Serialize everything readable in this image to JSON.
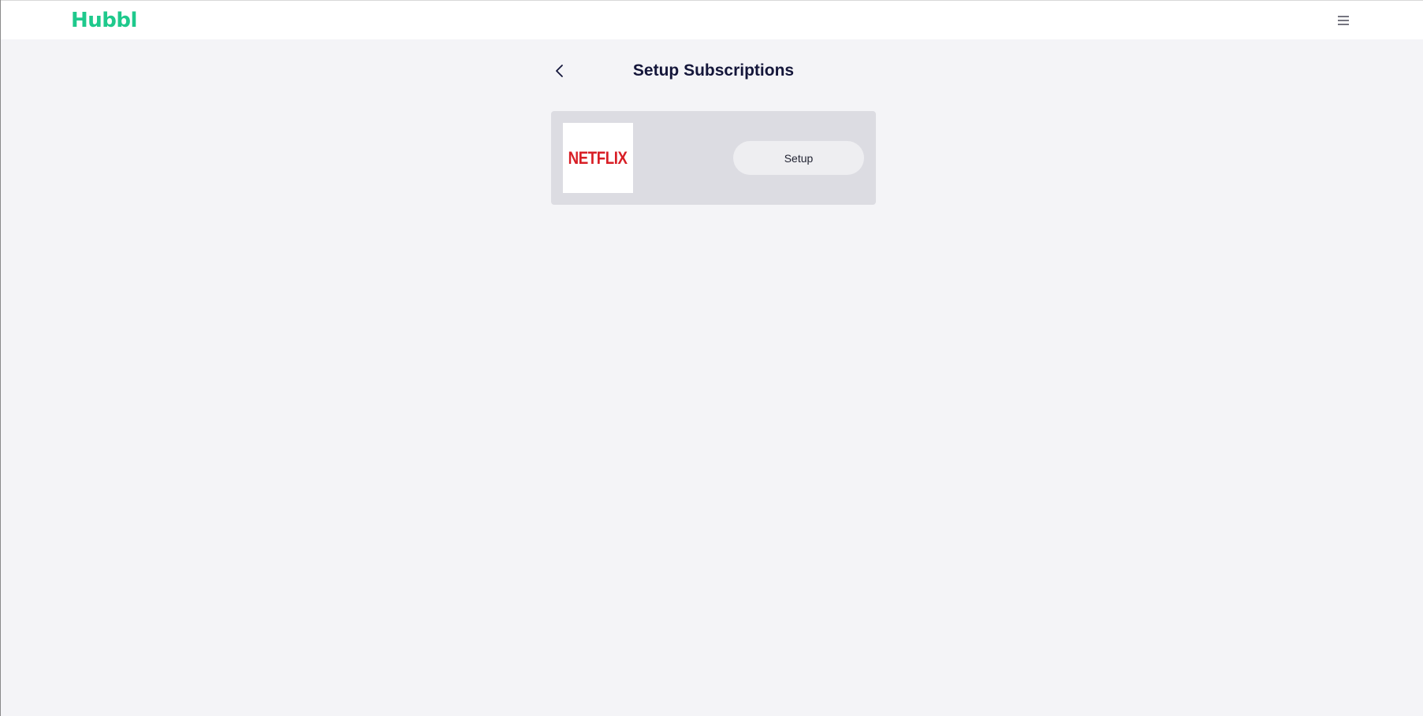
{
  "header": {
    "brand": "Hubbl",
    "menu_icon": "hamburger-menu-icon"
  },
  "page": {
    "back_icon": "chevron-left-icon",
    "title": "Setup Subscriptions"
  },
  "subscriptions": [
    {
      "service_logo_text": "NETFLIX",
      "action_label": "Setup"
    }
  ],
  "colors": {
    "brand": "#1ec98c",
    "page_background": "#f4f4f7",
    "card_background": "#dcdce2",
    "title_text": "#14163a",
    "netflix_red": "#d81f26"
  }
}
